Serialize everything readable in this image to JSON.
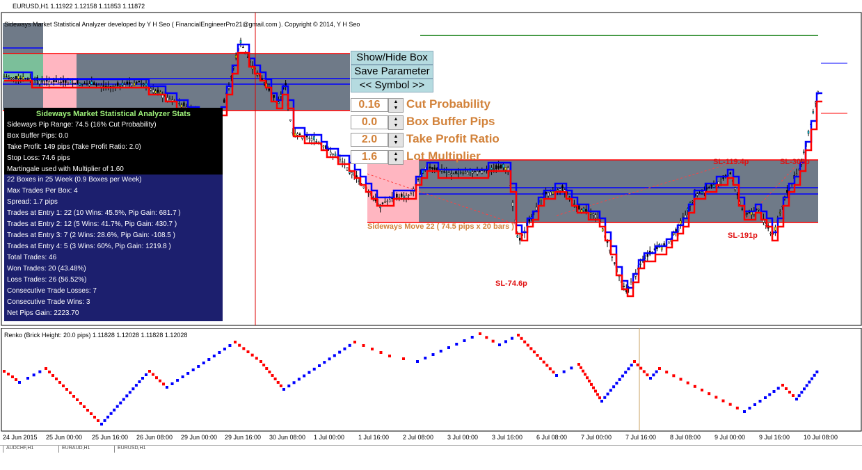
{
  "header": {
    "symbol_line": "EURUSD,H1  1.11922 1.12158 1.11853 1.11872",
    "developer_note": "Sideways Market Statistical Analyzer developed by Y H Seo ( FinancialEngineerPro21@gmail.com ). Copyright © 2014, Y H Seo"
  },
  "controls": {
    "show_hide_box": "Show/Hide Box",
    "save_parameter": "Save Parameter",
    "symbol_nav": "<<   Symbol   >>"
  },
  "params": [
    {
      "value": "0.16",
      "label": "Cut Probability"
    },
    {
      "value": "0.0",
      "label": "Box Buffer Pips"
    },
    {
      "value": "2.0",
      "label": "Take Profit Ratio"
    },
    {
      "value": "1.6",
      "label": "Lot Multiplier"
    }
  ],
  "stats": {
    "title": "Sideways Market Statistical Analyzer Stats",
    "head_lines": [
      "Sideways Pip Range: 74.5 (16% Cut Probability)",
      "Box Buffer Pips: 0.0",
      "Take Profit: 149 pips (Take Profit Ratio: 2.0)",
      "Stop Loss: 74.6 pips",
      "Martingale used with Multiplier of 1.60"
    ],
    "body_lines": [
      "22 Boxes in 25 Week (0.9 Boxes per Week)",
      "Max Trades Per Box: 4",
      "Spread: 1.7 pips",
      "Trades at Entry 1: 22 (10 Wins: 45.5%, Pip Gain: 681.7 )",
      "Trades at Entry 2: 12 (5 Wins: 41.7%, Pip Gain: 430.7 )",
      "Trades at Entry 3: 7 (2 Wins: 28.6%, Pip Gain: -108.5 )",
      "Trades at Entry 4: 5 (3 Wins: 60%, Pip Gain: 1219.8 )",
      "Total Trades: 46",
      "Won Trades: 20  (43.48%)",
      "Loss Trades: 26 (56.52%)",
      "Consecutive Trade Losses: 7",
      "Consecutive Trade Wins: 3",
      "Net Pips Gain: 2223.70"
    ]
  },
  "chart_labels": {
    "sl_1": "SL-74.6p",
    "sl_2": "SL-119.4p",
    "sl_3": "SL-191p",
    "sl_4": "SL-306p",
    "sideways_move": "Sideways Move 22 ( 74.5 pips x 20 bars )"
  },
  "renko": {
    "header": "Renko (Brick Height: 20.0 pips) 1.11828 1.12028 1.11828 1.12028"
  },
  "x_axis_ticks": [
    "24 Jun 2015",
    "25 Jun 00:00",
    "25 Jun 16:00",
    "26 Jun 08:00",
    "29 Jun 00:00",
    "29 Jun 16:00",
    "30 Jun 08:00",
    "1 Jul 00:00",
    "1 Jul 16:00",
    "2 Jul 08:00",
    "3 Jul 00:00",
    "3 Jul 16:00",
    "6 Jul 08:00",
    "7 Jul 00:00",
    "7 Jul 16:00",
    "8 Jul 08:00",
    "9 Jul 00:00",
    "9 Jul 16:00",
    "10 Jul 08:00"
  ],
  "tabs": [
    "AUDCHF,H1",
    "EURAUD,H1",
    "EURUSD,H1"
  ],
  "colors": {
    "box_grey": "#6f7a88",
    "box_pink": "#ffb6c1",
    "stats_navy": "#1c1f6e",
    "param_orange": "#d2823a",
    "bull": "#0000ff",
    "bear": "#ff0000",
    "level_green": "#0a7a0a"
  }
}
